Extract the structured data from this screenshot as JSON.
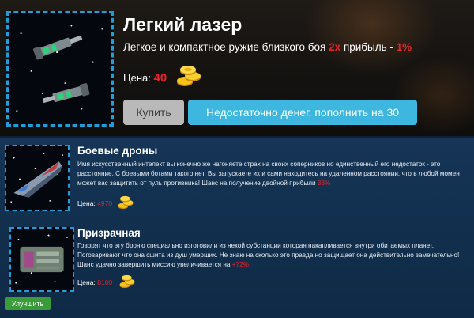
{
  "featured": {
    "title": "Легкий лазер",
    "description": "Легкое и компактное ружие близкого боя",
    "multiplier": "2x",
    "profit_label": "прибыль -",
    "profit_value": "1%",
    "price_label": "Цена:",
    "price_value": "40",
    "buy_button": "Купить",
    "topup_button": "Недостаточно денег, пополнить на 30"
  },
  "items": [
    {
      "title": "Боевые дроны",
      "description": "Имя искусственный интелект вы конечно же нагоняете страх на своих соперников но единственный его недостаток - это расстояние. С боевыми ботами такого нет. Вы запускаете их и сами находитесь на удаленном расстоянии, что в любой момент может вас защитить от пуль противника! Шанс на получение двойной прибыли",
      "highlight": "33%",
      "price_label": "Цена:",
      "price_value": "4970"
    },
    {
      "title": "Призрачная",
      "description": "Говорят что эту броню специально изготовили из некой субстанции которая накапливается внутри обитаемых планет. Поговаривают что она сшита из душ умерших. Не знаю на сколько это правда но защищает она действительно замечательно! Шанс удачно завершить миссию увеличивается на",
      "highlight": "+72%",
      "price_label": "Цена:",
      "price_value": "8100"
    }
  ],
  "upgrade_button": "Улучшить",
  "icons": [
    "laser-weapon-icon",
    "gold-coins-icon",
    "drone-icon",
    "ghost-armor-icon"
  ],
  "colors": {
    "accent_blue": "#3db7e0",
    "price_red": "#e8232a",
    "upgrade_green": "#3a9b3a",
    "disabled_grey": "#b9b9b9"
  }
}
